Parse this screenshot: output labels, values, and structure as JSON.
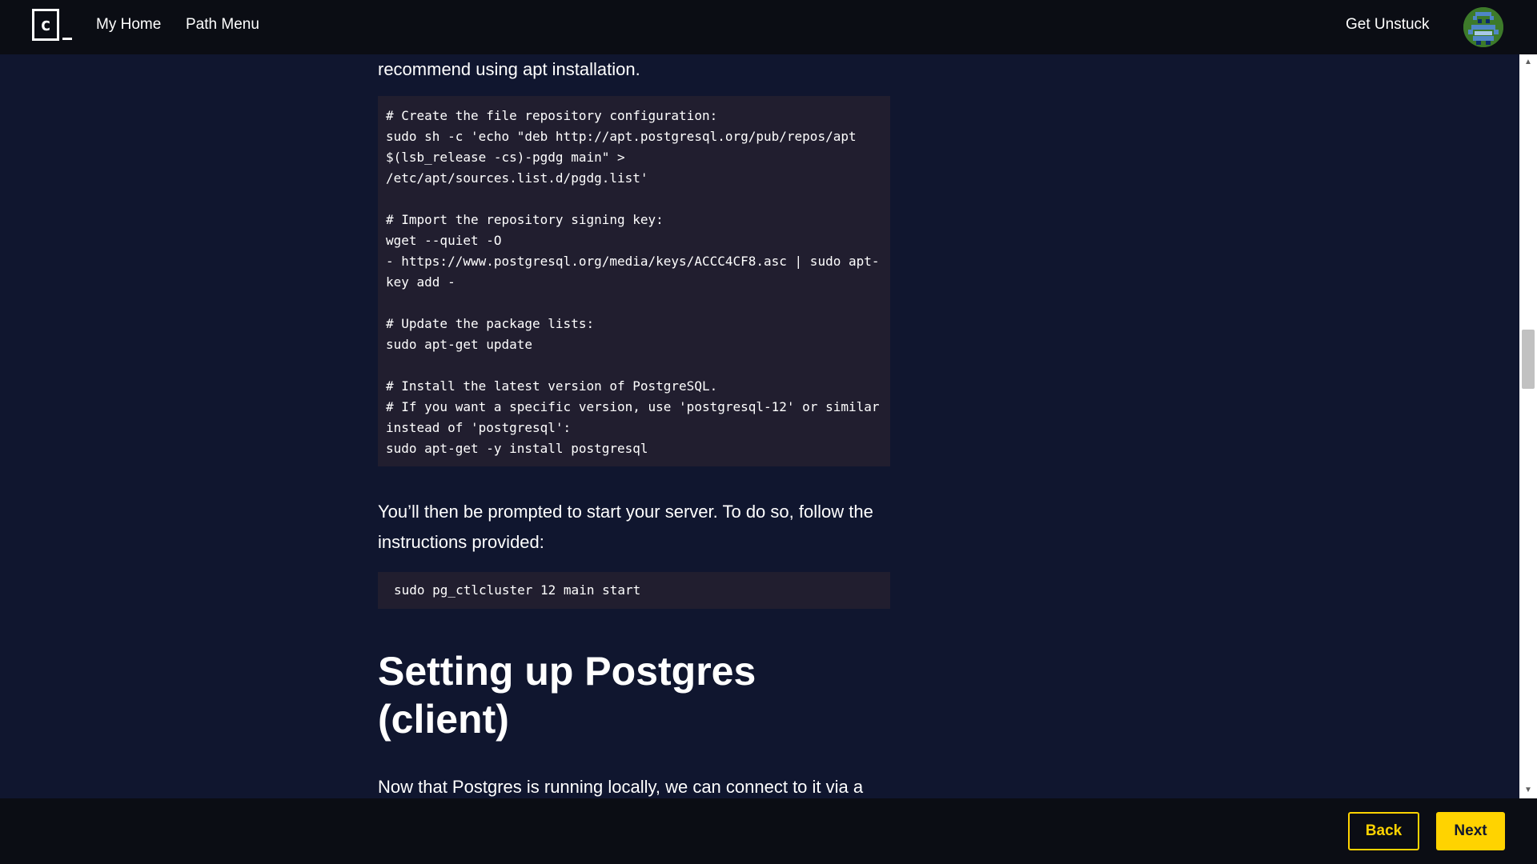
{
  "nav": {
    "logo_text": "c",
    "my_home": "My Home",
    "path_menu": "Path Menu",
    "get_unstuck": "Get Unstuck",
    "avatar_icon": "pixel-avatar-icon"
  },
  "article": {
    "intro_fragment": "recommend using apt installation.",
    "code_install": "# Create the file repository configuration:\nsudo sh -c 'echo \"deb http://apt.postgresql.org/pub/repos/apt\n$(lsb_release -cs)-pgdg main\" >\n/etc/apt/sources.list.d/pgdg.list'\n\n# Import the repository signing key:\nwget --quiet -O\n- https://www.postgresql.org/media/keys/ACCC4CF8.asc | sudo apt-\nkey add -\n\n# Update the package lists:\nsudo apt-get update\n\n# Install the latest version of PostgreSQL.\n# If you want a specific version, use 'postgresql-12' or similar\ninstead of 'postgresql':\nsudo apt-get -y install postgresql",
    "prompt_text": "You’ll then be prompted to start your server. To do so, follow the instructions provided:",
    "code_start": "sudo pg_ctlcluster 12 main start",
    "heading": "Setting up Postgres (client)",
    "next_para": "Now that Postgres is running locally, we can connect to it via a"
  },
  "footer": {
    "back_label": "Back",
    "next_label": "Next"
  },
  "colors": {
    "background": "#10162f",
    "bar": "#0b0d14",
    "code_bg": "#211e2f",
    "accent": "#ffd300"
  }
}
